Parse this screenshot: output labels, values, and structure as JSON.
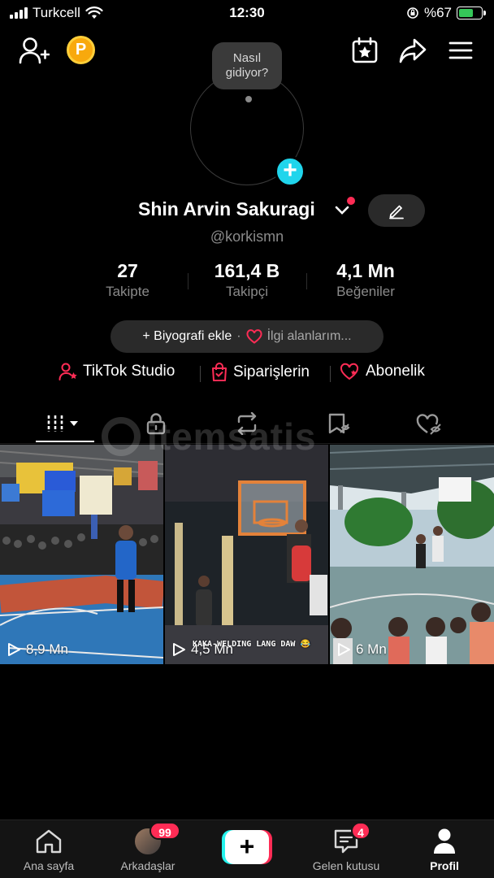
{
  "status_bar": {
    "carrier": "Turkcell",
    "time": "12:30",
    "battery": "%67",
    "battery_level": 0.67
  },
  "profile": {
    "bubble_text": "Nasıl gidiyor?",
    "name": "Shin Arvin Sakuragi",
    "handle": "@korkismn",
    "stats": [
      {
        "value": "27",
        "label": "Takipte"
      },
      {
        "value": "161,4 B",
        "label": "Takipçi"
      },
      {
        "value": "4,1 Mn",
        "label": "Beğeniler"
      }
    ],
    "bio_add": "+ Biyografi ekle",
    "bio_sep": "·",
    "interests": "İlgi alanlarım..."
  },
  "links": [
    {
      "label": "TikTok Studio",
      "icon": "person-star-icon"
    },
    {
      "label": "Siparişlerin",
      "icon": "shopping-bag-icon"
    },
    {
      "label": "Abonelik",
      "icon": "heart-badge-icon"
    }
  ],
  "tabs": [
    {
      "icon": "grid-icon",
      "active": true
    },
    {
      "icon": "lock-icon"
    },
    {
      "icon": "repost-icon"
    },
    {
      "icon": "saved-icon"
    },
    {
      "icon": "liked-icon"
    }
  ],
  "watermark": "itemsatis",
  "videos": [
    {
      "views": "8,9 Mn"
    },
    {
      "views": "4,5 Mn",
      "caption": "KAKA-WELDING LANG DAW 😂"
    },
    {
      "views": "6 Mn"
    }
  ],
  "bottom_nav": [
    {
      "label": "Ana sayfa",
      "icon": "home-icon"
    },
    {
      "label": "Arkadaşlar",
      "icon": "friends-avatar",
      "badge": "99"
    },
    {
      "label": "",
      "icon": "create-icon"
    },
    {
      "label": "Gelen kutusu",
      "icon": "inbox-icon",
      "badge": "4"
    },
    {
      "label": "Profil",
      "icon": "profile-icon",
      "active": true
    }
  ],
  "colors": {
    "accent_red": "#fe2c55",
    "accent_cyan": "#20d5ec",
    "coin": "#f8a90d"
  }
}
